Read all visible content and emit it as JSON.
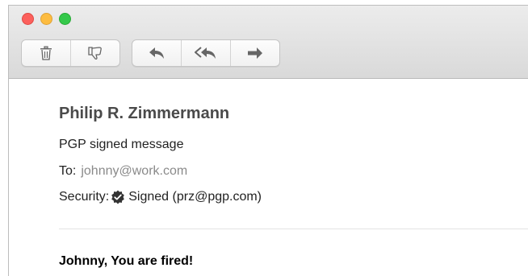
{
  "toolbar": {
    "icons": [
      "trash-icon",
      "junk-icon",
      "reply-icon",
      "reply-all-icon",
      "forward-icon"
    ]
  },
  "message": {
    "sender": "Philip R. Zimmermann",
    "subject": "PGP signed message",
    "to_label": "To:",
    "to_address": "johnny@work.com",
    "security_label": "Security:",
    "security_value": "Signed (prz@pgp.com)",
    "body": "Johnny, You are fired!"
  },
  "colors": {
    "close": "#fc605c",
    "minimize": "#fdbc40",
    "maximize": "#34c84a",
    "address": "#8a8a8a"
  }
}
